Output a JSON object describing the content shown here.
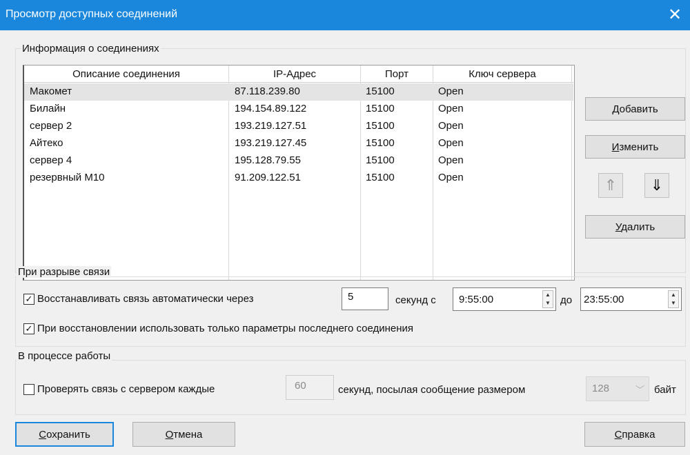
{
  "window": {
    "title": "Просмотр доступных соединений",
    "close_glyph": "✕"
  },
  "connections": {
    "group_label": "Информация о соединениях",
    "columns": [
      "Описание соединения",
      "IP-Адрес",
      "Порт",
      "Ключ сервера"
    ],
    "rows": [
      [
        "Макомет",
        "87.118.239.80",
        "15100",
        "Open"
      ],
      [
        "Билайн",
        "194.154.89.122",
        "15100",
        "Open"
      ],
      [
        "сервер 2",
        "193.219.127.51",
        "15100",
        "Open"
      ],
      [
        "Айтеко",
        "193.219.127.45",
        "15100",
        "Open"
      ],
      [
        "сервер 4",
        "195.128.79.55",
        "15100",
        "Open"
      ],
      [
        "резервный М10",
        "91.209.122.51",
        "15100",
        "Open"
      ]
    ],
    "selected_row": 0,
    "buttons": {
      "add": {
        "underline": "Д",
        "rest": "обавить"
      },
      "edit": {
        "underline": "И",
        "rest": "зменить"
      },
      "delete": {
        "underline": "У",
        "rest": "далить"
      },
      "move_up_icon": "arrow-up-icon",
      "move_down_icon": "arrow-down-icon"
    }
  },
  "disconnect": {
    "group_label": "При разрыве связи",
    "auto_reconnect": {
      "checked": true,
      "label": "Восстанавливать связь автоматически через"
    },
    "seconds_value": "5",
    "seconds_from_label": "секунд с",
    "from_time": "9:55:00",
    "to_label": "до",
    "to_time": "23:55:00",
    "use_last_params": {
      "checked": true,
      "label": "При восстановлении использовать только параметры последнего соединения"
    }
  },
  "runtime": {
    "group_label": "В процессе работы",
    "check_conn": {
      "checked": false,
      "label": "Проверять связь с сервером каждые"
    },
    "interval_value": "60",
    "message_label": "секунд, посылая сообщение размером",
    "size_value": "128",
    "size_unit": "байт"
  },
  "footer": {
    "save": {
      "underline": "С",
      "rest": "охранить"
    },
    "cancel": {
      "underline": "О",
      "rest": "тмена"
    },
    "help": {
      "underline": "С",
      "rest": "правка"
    }
  },
  "colors": {
    "title_bar": "#1a87dc",
    "dialog_bg": "#f0f0f0",
    "default_button_border": "#1a87dc"
  }
}
